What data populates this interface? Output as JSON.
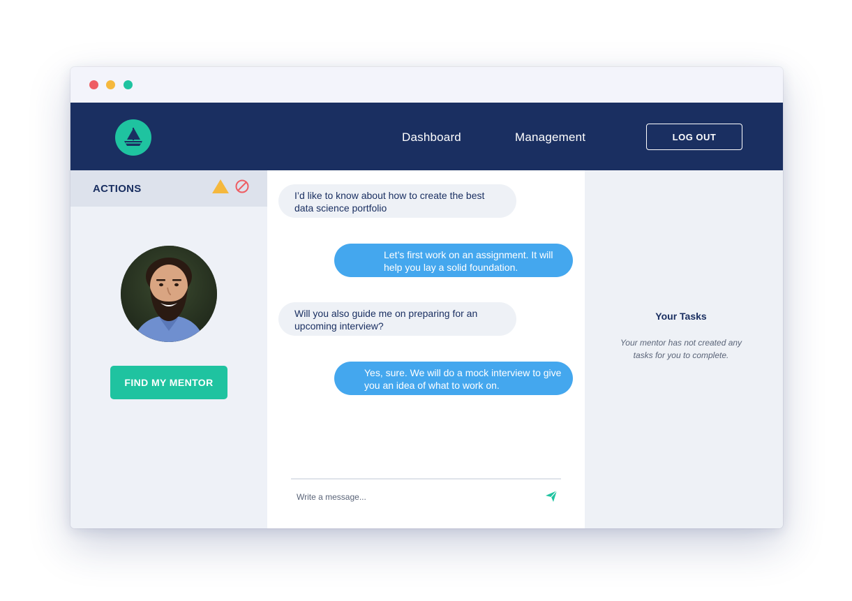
{
  "window": {
    "controls": [
      "close",
      "minimize",
      "maximize"
    ]
  },
  "header": {
    "logo_icon": "sailboat-icon",
    "nav": {
      "dashboard": "Dashboard",
      "management": "Management"
    },
    "logout_label": "LOG OUT"
  },
  "sidebar": {
    "actions_label": "ACTIONS",
    "icons": [
      "warning-icon",
      "block-icon"
    ],
    "find_mentor_label": "FIND MY MENTOR"
  },
  "chat": {
    "messages": [
      {
        "direction": "incoming",
        "text": "I’d like to know about how to create the best data science portfolio"
      },
      {
        "direction": "outgoing",
        "text": "Let’s first work on an assignment. It will help you lay a solid foundation."
      },
      {
        "direction": "incoming",
        "text": "Will you also guide me on preparing for an upcoming interview?"
      },
      {
        "direction": "outgoing",
        "text": "Yes, sure. We will do a mock interview to give you an idea of what to work on."
      }
    ],
    "input_placeholder": "Write a message...",
    "send_icon": "send-icon"
  },
  "tasks": {
    "title": "Your Tasks",
    "empty_message": "Your mentor has not created any tasks for you to complete."
  },
  "colors": {
    "navy": "#1a2f61",
    "teal": "#1fc3a0",
    "blue_bubble": "#44a7ee",
    "warning": "#f5b83d",
    "block": "#ee5d63"
  }
}
